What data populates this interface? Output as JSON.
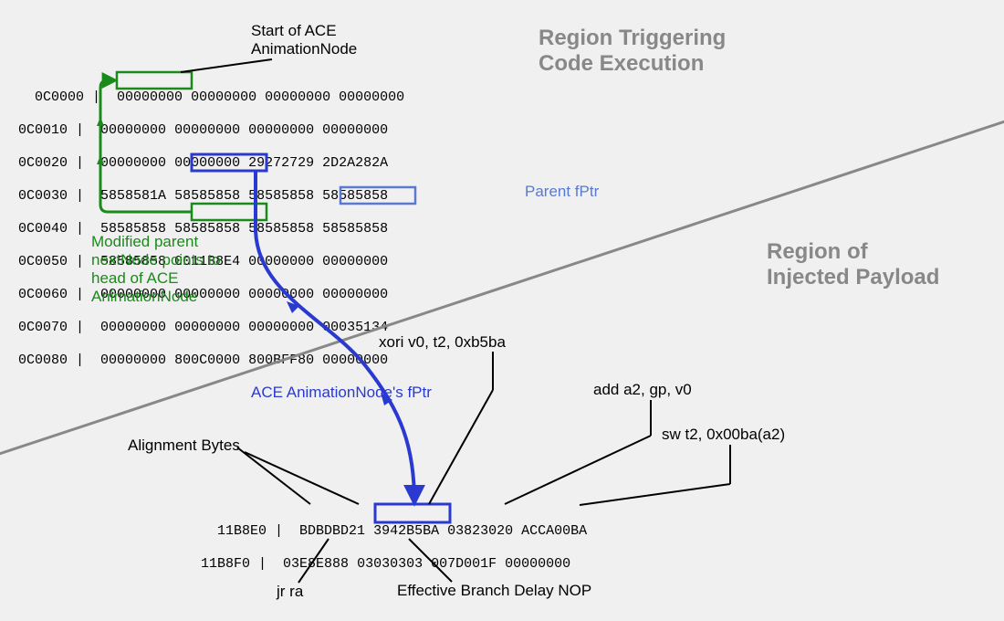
{
  "regions": {
    "trigger": "Region Triggering\nCode Execution",
    "payload": "Region of\nInjected Payload"
  },
  "labels": {
    "start_ace": "Start of ACE\nAnimationNode",
    "parent_fptr": "Parent fPtr",
    "modified_parent": "Modified parent\nnextNode points to\nhead of ACE\nAnimationNode",
    "ace_fptr": "ACE AnimationNode's fPtr",
    "alignment": "Alignment Bytes",
    "xori": "xori v0, t2, 0xb5ba",
    "add": "add a2, gp, v0",
    "sw": "sw t2, 0x00ba(a2)",
    "jr": "jr ra",
    "nop": "Effective Branch Delay NOP"
  },
  "hex_top": {
    "rows": [
      {
        "addr": "0C0000",
        "b": [
          "00000000",
          "00000000",
          "00000000",
          "00000000"
        ]
      },
      {
        "addr": "0C0010",
        "b": [
          "00000000",
          "00000000",
          "00000000",
          "00000000"
        ]
      },
      {
        "addr": "0C0020",
        "b": [
          "00000000",
          "00000000",
          "29272729",
          "2D2A282A"
        ]
      },
      {
        "addr": "0C0030",
        "b": [
          "5858581A",
          "58585858",
          "58585858",
          "58585858"
        ]
      },
      {
        "addr": "0C0040",
        "b": [
          "58585858",
          "58585858",
          "58585858",
          "58585858"
        ]
      },
      {
        "addr": "0C0050",
        "b": [
          "58585858",
          "0011B8E4",
          "00000000",
          "00000000"
        ]
      },
      {
        "addr": "0C0060",
        "b": [
          "00000000",
          "00000000",
          "00000000",
          "00000000"
        ]
      },
      {
        "addr": "0C0070",
        "b": [
          "00000000",
          "00000000",
          "00000000",
          "00035134"
        ]
      },
      {
        "addr": "0C0080",
        "b": [
          "00000000",
          "800C0000",
          "800BFF80",
          "00000000"
        ]
      }
    ]
  },
  "hex_bottom": {
    "rows": [
      {
        "addr": "11B8E0",
        "b": [
          "BDBDBD21",
          "3942B5BA",
          "03823020",
          "ACCA00BA"
        ]
      },
      {
        "addr": "11B8F0",
        "b": [
          "03E8E888",
          "03030303",
          "007D001F",
          "00000000"
        ]
      }
    ]
  }
}
